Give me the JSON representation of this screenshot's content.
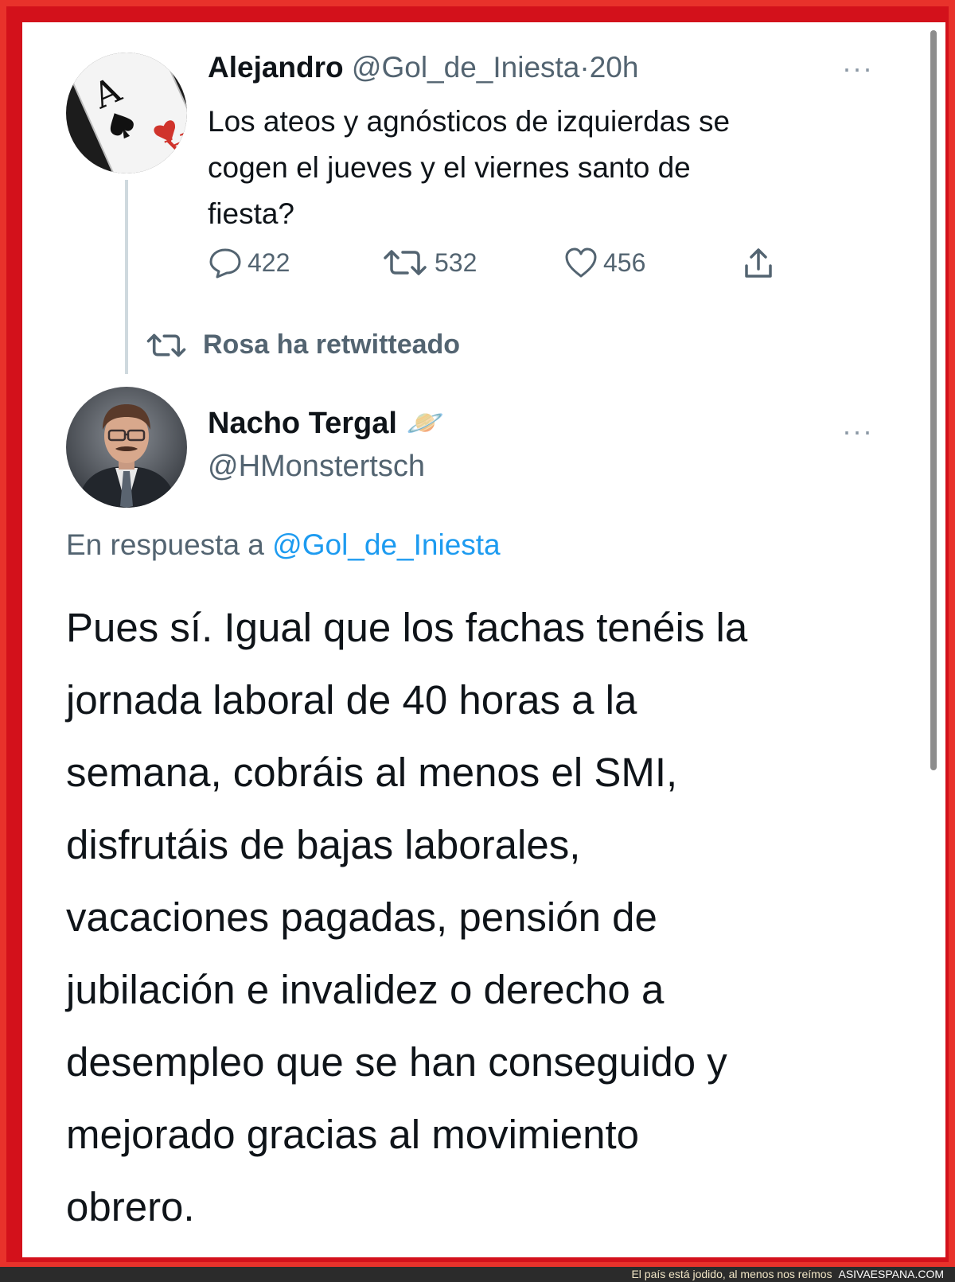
{
  "original_tweet": {
    "display_name": "Alejandro",
    "handle": "@Gol_de_Iniesta",
    "separator": "·",
    "time": "20h",
    "text_lines": [
      "Los ateos y agnósticos de izquierdas se",
      "cogen el jueves y el viernes santo de",
      "fiesta?"
    ],
    "actions": {
      "replies": "422",
      "retweets": "532",
      "likes": "456"
    },
    "more_icon": "ellipsis-icon",
    "avatar_icon": "ace-of-hearts-card"
  },
  "retweet_context": {
    "label": "Rosa ha retwitteado",
    "icon": "retweet-icon"
  },
  "reply_tweet": {
    "display_name": "Nacho Tergal",
    "name_emoji": "🪐",
    "handle": "@HMonstertsch",
    "reply_prefix": "En respuesta a",
    "reply_to": "@Gol_de_Iniesta",
    "text_lines": [
      "Pues sí. Igual que los fachas tenéis la",
      "jornada laboral de 40 horas a la",
      "semana, cobráis al menos el SMI,",
      "disfrutáis de bajas laborales,",
      "vacaciones pagadas, pensión de",
      "jubilación e invalidez o derecho a",
      "desempleo que se han conseguido y",
      "mejorado gracias al movimiento",
      "obrero."
    ],
    "more_icon": "ellipsis-icon",
    "avatar_icon": "man-portrait"
  },
  "footer": {
    "tagline": "El país está jodido, al menos nos reímos",
    "site": "ASIVAESPANA.COM"
  },
  "colors": {
    "border_red": "#e8322b",
    "text_primary": "#0f1419",
    "text_secondary": "#536471",
    "link_blue": "#1d9bf0"
  }
}
